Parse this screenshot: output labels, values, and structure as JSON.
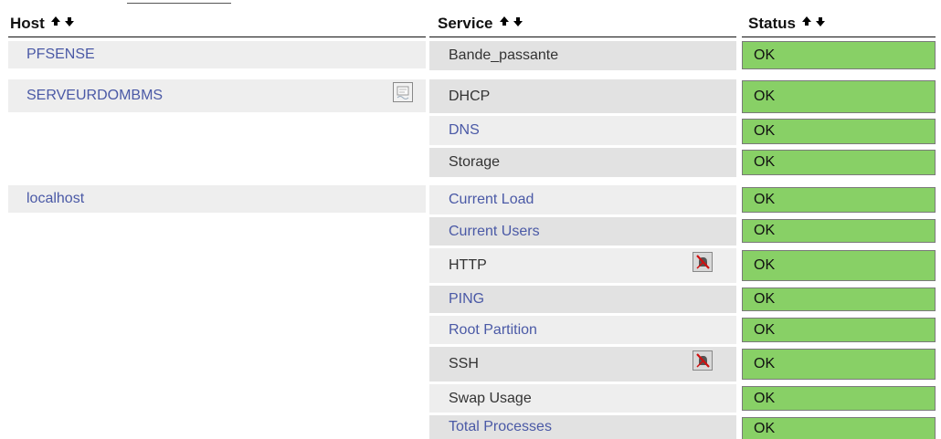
{
  "table": {
    "columns": [
      {
        "label": "Host"
      },
      {
        "label": "Service"
      },
      {
        "label": "Status"
      }
    ]
  },
  "hosts": [
    {
      "name": "PFSENSE"
    },
    {
      "name": "SERVEURDOMBMS",
      "icon": "notes-icon"
    },
    {
      "name": "localhost"
    }
  ],
  "services": [
    {
      "host": "PFSENSE",
      "name": "Bande_passante",
      "status": "OK",
      "link": false
    },
    {
      "host": "SERVEURDOMBMS",
      "name": "DHCP",
      "status": "OK",
      "link": false
    },
    {
      "host": "SERVEURDOMBMS",
      "name": "DNS",
      "status": "OK",
      "link": true
    },
    {
      "host": "SERVEURDOMBMS",
      "name": "Storage",
      "status": "OK",
      "link": false
    },
    {
      "host": "localhost",
      "name": "Current Load",
      "status": "OK",
      "link": true
    },
    {
      "host": "localhost",
      "name": "Current Users",
      "status": "OK",
      "link": true
    },
    {
      "host": "localhost",
      "name": "HTTP",
      "status": "OK",
      "link": false,
      "icon": "notifications-disabled-icon"
    },
    {
      "host": "localhost",
      "name": "PING",
      "status": "OK",
      "link": true
    },
    {
      "host": "localhost",
      "name": "Root Partition",
      "status": "OK",
      "link": true
    },
    {
      "host": "localhost",
      "name": "SSH",
      "status": "OK",
      "link": false,
      "icon": "notifications-disabled-icon"
    },
    {
      "host": "localhost",
      "name": "Swap Usage",
      "status": "OK",
      "link": false
    },
    {
      "host": "localhost",
      "name": "Total Processes",
      "status": "OK",
      "link": true
    }
  ],
  "colors": {
    "status_ok": "#88d066",
    "link": "#4a59a6",
    "row_dark": "#e2e2e2",
    "row_light": "#eeeeee"
  }
}
